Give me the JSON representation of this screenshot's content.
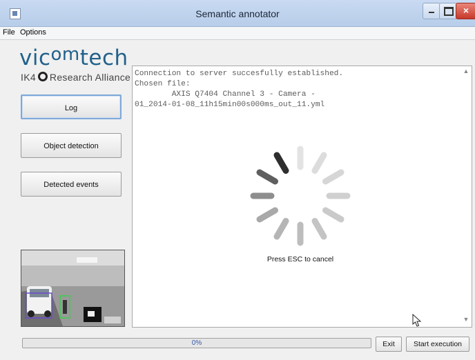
{
  "window": {
    "title": "Semantic annotator"
  },
  "menu": [
    {
      "label": "File"
    },
    {
      "label": "Options"
    }
  ],
  "brand": {
    "logo_pre": "vic",
    "logo_hi": "om",
    "logo_post": "tech",
    "alliance_pre": "IK4",
    "alliance_post": "Research Alliance"
  },
  "sidebar": {
    "buttons": [
      {
        "label": "Log",
        "selected": true
      },
      {
        "label": "Object detection",
        "selected": false
      },
      {
        "label": "Detected events",
        "selected": false
      }
    ]
  },
  "log": {
    "text": "Connection to server succesfully established.\nChosen file:\n        AXIS Q7404 Channel 3 - Camera -\n01_2014-01-08_11h15min00s000ms_out_11.yml"
  },
  "spinner": {
    "message": "Press ESC to cancel"
  },
  "status": {
    "progress_label": "0%",
    "progress_value": 0,
    "exit_label": "Exit",
    "start_label": "Start execution"
  },
  "colors": {
    "accent": "#4b80c9",
    "logo": "#21618a",
    "close": "#c7392a"
  },
  "icons": {
    "app": "app-icon",
    "minimize": "minimize-icon",
    "maximize": "maximize-icon",
    "close": "close-icon",
    "spinner": "loading-spinner",
    "cursor": "mouse-cursor"
  }
}
